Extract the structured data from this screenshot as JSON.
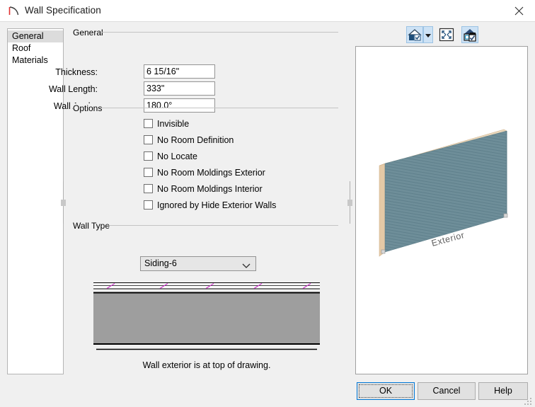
{
  "window": {
    "title": "Wall Specification",
    "icon": "wall-curve-icon",
    "close_label": "×"
  },
  "sidebar": {
    "items": [
      {
        "label": "General",
        "selected": true
      },
      {
        "label": "Roof",
        "selected": false
      },
      {
        "label": "Materials",
        "selected": false
      }
    ]
  },
  "general_group": {
    "legend": "General",
    "fields": [
      {
        "label": "Thickness:",
        "value": "6 15/16\""
      },
      {
        "label": "Wall Length:",
        "value": "333\""
      },
      {
        "label": "Wall Angle:",
        "value": "180.0°"
      }
    ]
  },
  "options_group": {
    "legend": "Options",
    "checkboxes": [
      {
        "label": "Invisible",
        "checked": false
      },
      {
        "label": "No Room Definition",
        "checked": false
      },
      {
        "label": "No Locate",
        "checked": false
      },
      {
        "label": "No Room Moldings Exterior",
        "checked": false
      },
      {
        "label": "No Room Moldings Interior",
        "checked": false
      },
      {
        "label": "Ignored by Hide Exterior Walls",
        "checked": false
      }
    ]
  },
  "walltype_group": {
    "legend": "Wall Type",
    "selected": "Siding-6",
    "options": [
      "Siding-6"
    ],
    "caption": "Wall exterior is at top of drawing."
  },
  "preview": {
    "toolbar": [
      {
        "name": "view-style-house-icon",
        "active": true
      },
      {
        "name": "view-style-dropdown-arrow",
        "active": false
      },
      {
        "name": "fill-window-icon",
        "active": false
      },
      {
        "name": "preview-options-house-icon",
        "active": true
      }
    ],
    "wall_label": "Exterior"
  },
  "buttons": {
    "ok": "OK",
    "cancel": "Cancel",
    "help": "Help"
  },
  "colors": {
    "accent": "#0078d7",
    "wall_face": "#6e8e99",
    "wall_edge": "#e4c9a6",
    "section_fill": "#9e9e9e",
    "hatch": "#cc33cc",
    "toolbar_active": "#cde2f5"
  }
}
